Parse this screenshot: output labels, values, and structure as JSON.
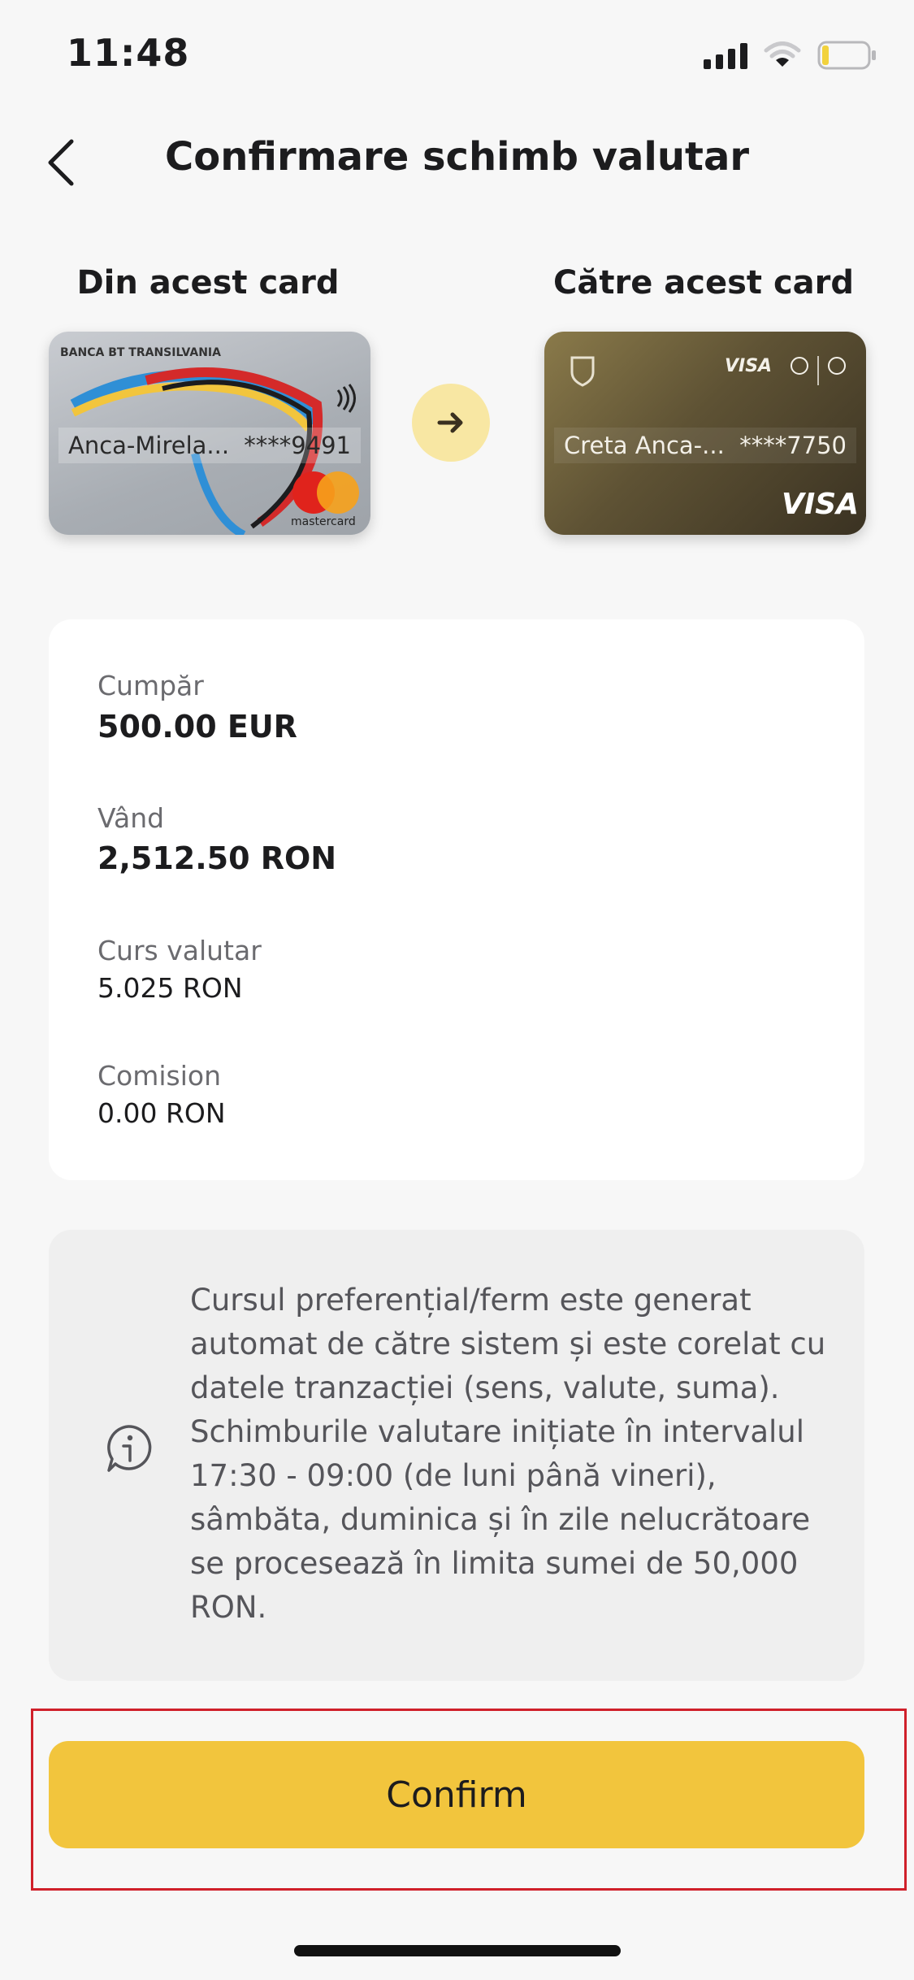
{
  "status_bar": {
    "time": "11:48",
    "icons": [
      "signal-icon",
      "wifi-icon",
      "battery-icon"
    ]
  },
  "header": {
    "back_icon": "chevron-left-icon",
    "title": "Confirmare schimb valutar"
  },
  "transfer": {
    "from_label": "Din acest card",
    "to_label": "Către acest card",
    "arrow_icon": "arrow-right-icon",
    "from_card": {
      "brand_text": "BANCA BT TRANSILVANIA",
      "holder": "Anca-Mirela...",
      "masked_number": "****9491",
      "network": "mastercard"
    },
    "to_card": {
      "holder": "Creta Anca-...",
      "masked_number": "****7750",
      "network": "VISA",
      "partner_text": "VISA"
    }
  },
  "details": {
    "buy_label": "Cumpăr",
    "buy_value": "500.00 EUR",
    "sell_label": "Vând",
    "sell_value": "2,512.50 RON",
    "rate_label": "Curs valutar",
    "rate_value": "5.025 RON",
    "fee_label": "Comision",
    "fee_value": "0.00 RON"
  },
  "info": {
    "icon": "info-icon",
    "lines": [
      "Cursul preferențial/ferm este generat",
      "automat de către sistem și este corelat cu",
      "datele tranzacției (sens, valute, suma).",
      "Schimburile valutare inițiate în intervalul",
      "17:30 - 09:00 (de luni până vineri),",
      "sâmbăta, duminica și în zile nelucrătoare",
      "se procesează în limita sumei de 50,000",
      "RON."
    ]
  },
  "actions": {
    "confirm_label": "Confirm"
  },
  "colors": {
    "accent": "#f2c53d",
    "arrow_bg": "#f8e7a3",
    "highlight_outline": "#d0202a"
  }
}
